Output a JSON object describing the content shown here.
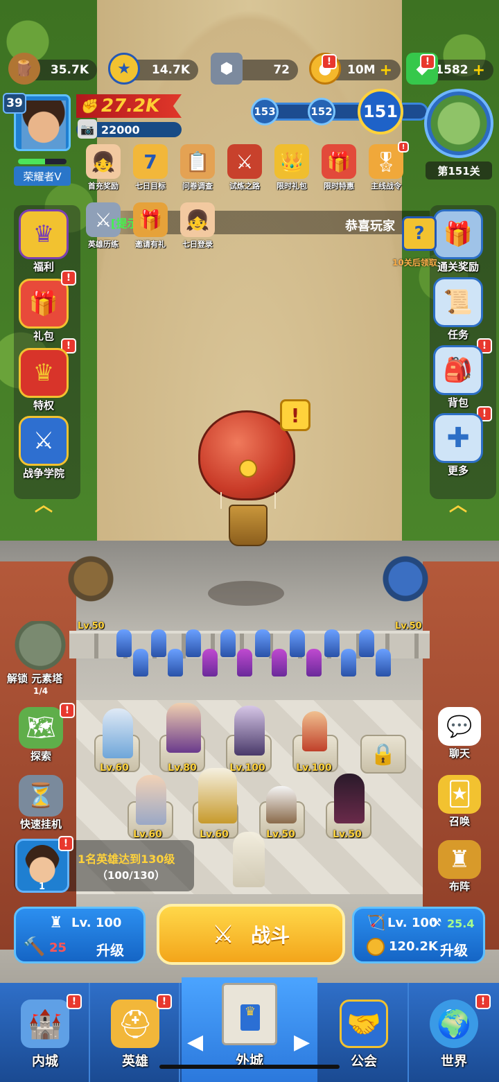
{
  "resources": {
    "wood": "35.7K",
    "gold_medal": "14.7K",
    "iron": "72",
    "coins": "10M",
    "gems": "1582"
  },
  "player": {
    "level": "39",
    "power": "27.2K",
    "sub_power": "22000",
    "rank": "荣耀者Ⅴ",
    "xp_fraction": 0.55
  },
  "stage": {
    "next2": "153",
    "next1": "152",
    "current": "151",
    "map_label": "第151关"
  },
  "events_row1": [
    {
      "label": "首充奖励",
      "icon": "girl-icon"
    },
    {
      "label": "七日目标",
      "icon": "seven-badge-icon"
    },
    {
      "label": "问卷调查",
      "icon": "survey-icon"
    },
    {
      "label": "试炼之路",
      "icon": "trial-icon"
    },
    {
      "label": "限时礼包",
      "icon": "crown-gift-icon"
    },
    {
      "label": "限时特惠",
      "icon": "gift-icon"
    },
    {
      "label": "主线战令",
      "icon": "battle-pass-icon"
    }
  ],
  "events_row2": [
    {
      "label": "英雄历练",
      "icon": "hero-training-icon"
    },
    {
      "label": "邀请有礼",
      "icon": "invite-icon"
    },
    {
      "label": "七日登录",
      "icon": "girl-icon"
    }
  ],
  "tip_tag": "[提示]",
  "notice": "恭喜玩家",
  "left_menu": [
    "福利",
    "礼包",
    "特权",
    "战争学院"
  ],
  "right_menu": [
    "通关奖励",
    "任务",
    "背包",
    "更多"
  ],
  "reward_hint": "10关后领取",
  "towers": {
    "left_lv": "Lv.50",
    "right_lv": "Lv.50"
  },
  "element_tower": {
    "label": "解锁 元素塔",
    "count": "1/4"
  },
  "heroes_row1": [
    "Lv.60",
    "Lv.80",
    "Lv.100",
    "Lv.100"
  ],
  "heroes_row2": [
    "Lv.60",
    "Lv.60",
    "Lv.50",
    "Lv.50"
  ],
  "left_actions": [
    "探索",
    "快速挂机"
  ],
  "right_actions": [
    "聊天",
    "召唤",
    "布阵"
  ],
  "quest": {
    "title": "1名英雄达到130级",
    "progress": "（100/130）",
    "count": "1"
  },
  "wall_upgrade": {
    "level": "Lv. 100",
    "cost": "25",
    "label": "升级"
  },
  "fight_label": "战斗",
  "archer_upgrade": {
    "level": "Lv. 100",
    "power": "25.4",
    "cost": "120.2K",
    "label": "升级"
  },
  "tabs": [
    "内城",
    "英雄",
    "外城",
    "公会",
    "世界"
  ],
  "colors": {
    "accent_yellow": "#ffd23b",
    "tab_blue": "#2f6fc8",
    "alert_red": "#e8382e"
  }
}
